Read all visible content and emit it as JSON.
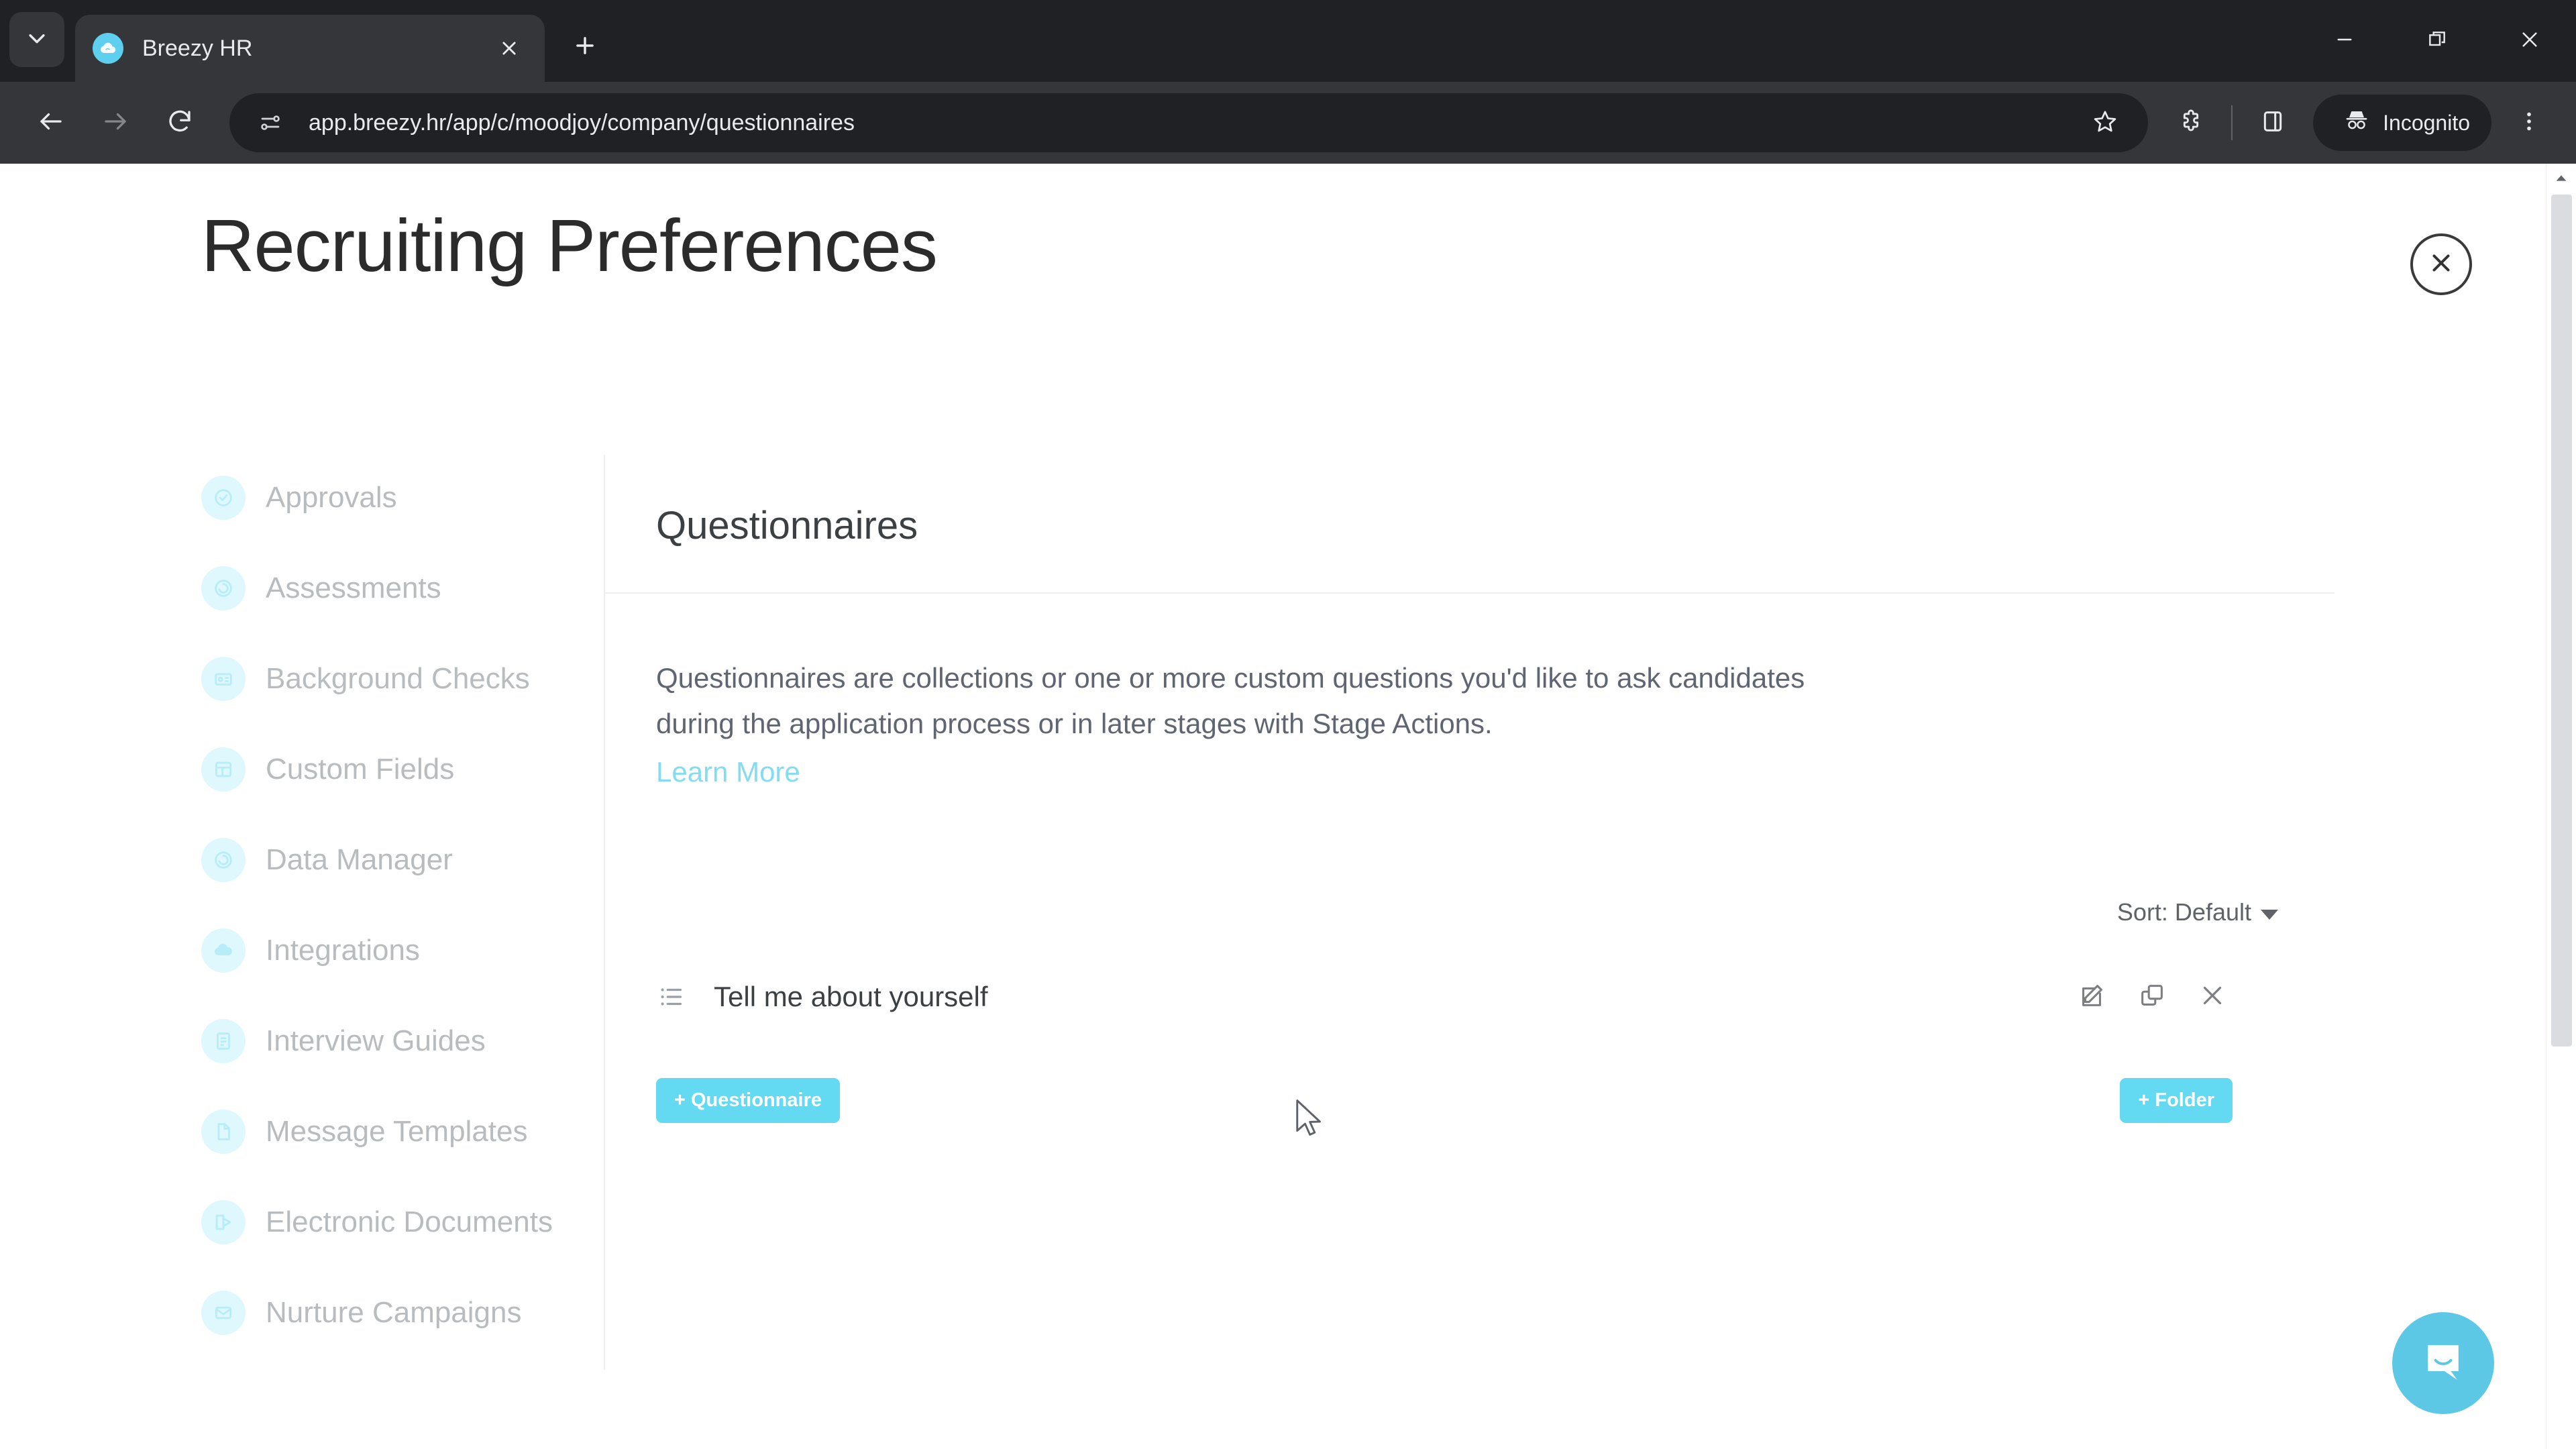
{
  "browser": {
    "tab": {
      "title": "Breezy HR",
      "favicon_icon": "breezy-cloud-icon",
      "close_icon": "close-icon"
    },
    "tab_list_icon": "chevron-down-icon",
    "new_tab_icon": "plus-icon",
    "window_controls": {
      "minimize_icon": "minimize-icon",
      "restore_icon": "restore-icon",
      "close_icon": "close-icon"
    },
    "toolbar": {
      "back_icon": "arrow-left-icon",
      "forward_icon": "arrow-right-icon",
      "reload_icon": "reload-icon",
      "site_info_icon": "site-settings-icon",
      "url": "app.breezy.hr/app/c/moodjoy/company/questionnaires",
      "bookmark_icon": "star-icon",
      "extensions_icon": "puzzle-piece-icon",
      "side_panel_icon": "side-panel-icon",
      "incognito_icon": "incognito-hat-icon",
      "incognito_label": "Incognito",
      "menu_icon": "three-dot-menu-icon"
    }
  },
  "page": {
    "title": "Recruiting Preferences",
    "close_icon": "close-circle-icon",
    "sidebar": {
      "items": [
        {
          "label": "Approvals",
          "icon": "approvals-icon"
        },
        {
          "label": "Assessments",
          "icon": "assessments-icon"
        },
        {
          "label": "Background Checks",
          "icon": "background-checks-icon"
        },
        {
          "label": "Custom Fields",
          "icon": "custom-fields-icon"
        },
        {
          "label": "Data Manager",
          "icon": "data-manager-icon"
        },
        {
          "label": "Integrations",
          "icon": "integrations-icon"
        },
        {
          "label": "Interview Guides",
          "icon": "interview-guides-icon"
        },
        {
          "label": "Message Templates",
          "icon": "message-templates-icon"
        },
        {
          "label": "Electronic Documents",
          "icon": "electronic-documents-icon"
        },
        {
          "label": "Nurture Campaigns",
          "icon": "nurture-campaigns-icon"
        }
      ]
    },
    "card": {
      "title": "Questionnaires",
      "description": "Questionnaires are collections or one or more custom questions you'd like to ask candidates during the application process or in later stages with Stage Actions.",
      "learn_more_label": "Learn More",
      "sort_label": "Sort: Default",
      "sort_caret_icon": "caret-down-icon",
      "items": [
        {
          "label": "Tell me about yourself",
          "list_icon": "list-icon",
          "edit_icon": "edit-pencil-icon",
          "duplicate_icon": "duplicate-icon",
          "delete_icon": "close-icon"
        }
      ],
      "add_questionnaire_label": "+ Questionnaire",
      "add_folder_label": "+ Folder"
    },
    "intercom_icon": "intercom-chat-icon",
    "scrollbar_up_icon": "scroll-up-arrow-icon"
  },
  "colors": {
    "accent": "#63d9f2",
    "link": "#84dcf2",
    "sidebar_icon_bg": "#d4f6fd",
    "intercom_bg": "#5cc8e6",
    "browser_chrome": "#35363a",
    "tabstrip": "#202124"
  }
}
